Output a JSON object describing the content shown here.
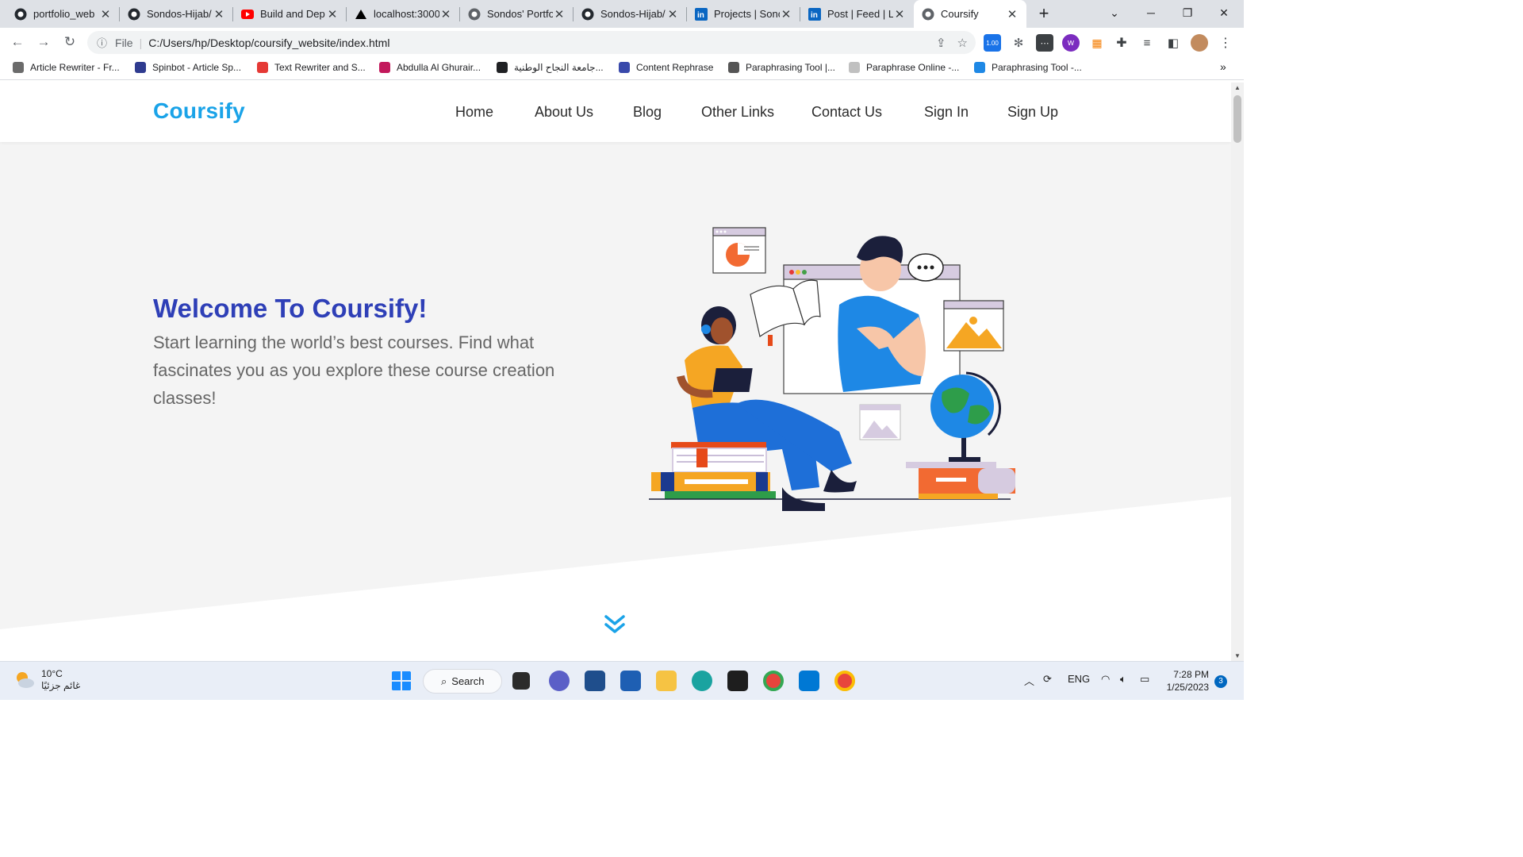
{
  "browser": {
    "tabs": [
      {
        "title": "portfolio_web",
        "icon": "github-icon"
      },
      {
        "title": "Sondos-Hijab/",
        "icon": "github-icon"
      },
      {
        "title": "Build and Dep",
        "icon": "youtube-icon"
      },
      {
        "title": "localhost:3000",
        "icon": "vercel-icon"
      },
      {
        "title": "Sondos' Portfo",
        "icon": "globe-icon"
      },
      {
        "title": "Sondos-Hijab/",
        "icon": "github-icon"
      },
      {
        "title": "Projects | Sonc",
        "icon": "linkedin-icon"
      },
      {
        "title": "Post | Feed | Li",
        "icon": "linkedin-icon"
      },
      {
        "title": "Coursify",
        "icon": "globe-icon",
        "active": true
      }
    ],
    "address": {
      "scheme": "File",
      "url": "C:/Users/hp/Desktop/coursify_website/index.html"
    },
    "bookmarks": [
      {
        "label": "Article Rewriter - Fr...",
        "color": "#6b6b6b"
      },
      {
        "label": "Spinbot - Article Sp...",
        "color": "#2f3b8f"
      },
      {
        "label": "Text Rewriter and S...",
        "color": "#e53935"
      },
      {
        "label": "Abdulla Al Ghurair...",
        "color": "#c2185b"
      },
      {
        "label": "جامعة النجاح الوطنية...",
        "color": "#202124"
      },
      {
        "label": "Content Rephrase",
        "color": "#3949ab"
      },
      {
        "label": "Paraphrasing Tool |...",
        "color": "#555555"
      },
      {
        "label": "Paraphrase Online -...",
        "color": "#c0c0c0"
      },
      {
        "label": "Paraphrasing Tool -...",
        "color": "#1e88e5"
      }
    ],
    "bookmarks_more": "»",
    "extension_badge": "1.00"
  },
  "site": {
    "logo": "Coursify",
    "nav": [
      "Home",
      "About Us",
      "Blog",
      "Other Links",
      "Contact Us",
      "Sign In",
      "Sign Up"
    ],
    "hero": {
      "title": "Welcome To Coursify!",
      "text": "Start learning the world’s best courses. Find what fascinates you as you explore these course creation classes!"
    },
    "colors": {
      "logo": "#1aa3e8",
      "title": "#2e3fb7",
      "chevron": "#1aa3e8"
    }
  },
  "taskbar": {
    "weather": {
      "temp": "10°C",
      "condition": "غائم جزئيًا"
    },
    "search_label": "Search",
    "tray": {
      "language": "ENG",
      "time": "7:28 PM",
      "date": "1/25/2023",
      "notifications": "3"
    }
  }
}
